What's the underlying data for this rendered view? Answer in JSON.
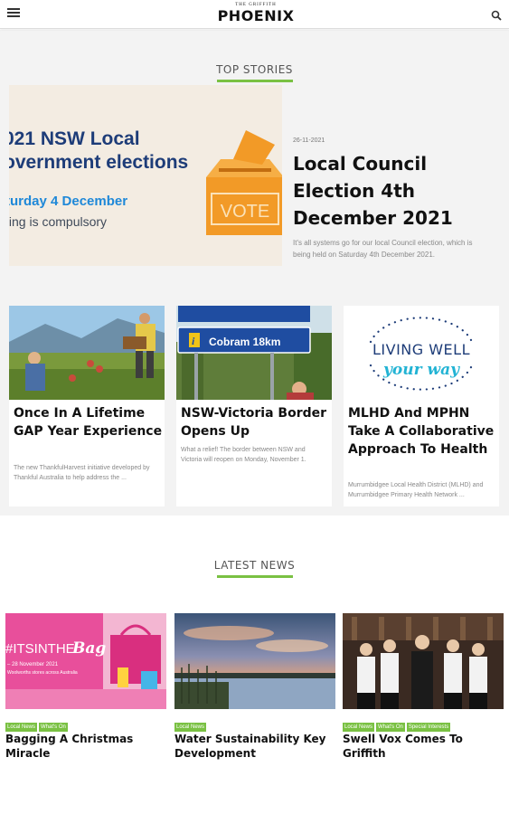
{
  "header": {
    "logo_small": "THE GRIFFITH",
    "logo_big": "PHOENIX",
    "menu_icon": "menu-icon",
    "search_icon": "search-icon"
  },
  "top_stories": {
    "heading": "TOP STORIES",
    "hero": {
      "image_text": {
        "line1": "021 NSW Local",
        "line2": "overnment elections",
        "line3": "turday 4 December",
        "line4": "ting is compulsory",
        "ballot_label": "VOTE"
      },
      "date": "26-11-2021",
      "title": "Local Council Election 4th December 2021",
      "excerpt": "It's all systems go for our local Council election, which is being held on Saturday 4th December 2021."
    },
    "cards": [
      {
        "title": "Once In A Lifetime GAP Year Experience",
        "excerpt": "The new ThankfulHarvest initiative developed by Thankful Australia to help address the ..."
      },
      {
        "title": "NSW-Victoria Border Opens Up",
        "excerpt": "What a relief! The border between NSW and Victoria will reopen on Monday, November 1.",
        "sign_text": "Cobram 18km"
      },
      {
        "title": " MLHD And MPHN Take A Collaborative Approach To Health",
        "excerpt": "Murrumbidgee Local Health District (MLHD) and Murrumbidgee Primary Health Network ...",
        "logo_line1": "LIVING WELL",
        "logo_line2": "your way"
      }
    ]
  },
  "latest_news": {
    "heading": "LATEST NEWS",
    "items": [
      {
        "tags": [
          "Local News",
          "What's On"
        ],
        "title": "Bagging A Christmas Miracle",
        "image_text": {
          "hashtag": "#ITSINTHE",
          "script": "Bag",
          "date_line": "– 28 November 2021",
          "sub_line": "Woolworths stores across Australia"
        }
      },
      {
        "tags": [
          "Local News"
        ],
        "title": "Water Sustainability Key Development"
      },
      {
        "tags": [
          "Local News",
          "What's On",
          "Special Interests"
        ],
        "title": "Swell Vox Comes To Griffith"
      }
    ]
  },
  "colors": {
    "accent_green": "#7ac143",
    "section_bg": "#f3f3f3",
    "navy": "#1d3c78"
  }
}
